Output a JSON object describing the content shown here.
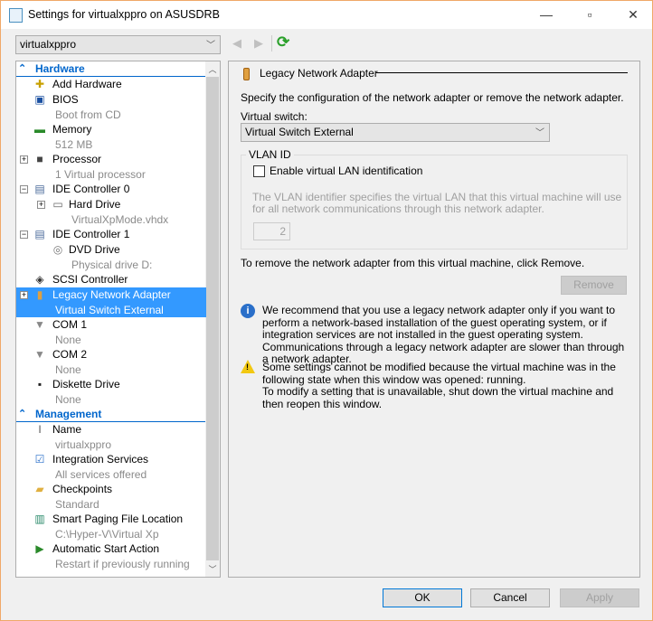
{
  "window": {
    "title": "Settings for virtualxppro on ASUSDRB",
    "minimize": "—",
    "maximize": "▫",
    "close": "✕"
  },
  "vm_selector": {
    "value": "virtualxppro"
  },
  "toolbar": {
    "back": "◀",
    "forward": "▶",
    "refresh": "⟳"
  },
  "tree": {
    "hardware_header": "Hardware",
    "management_header": "Management",
    "hardware": [
      {
        "label": "Add Hardware",
        "sub": null,
        "icon": "add-hardware-icon"
      },
      {
        "label": "BIOS",
        "sub": "Boot from CD",
        "icon": "bios-icon"
      },
      {
        "label": "Memory",
        "sub": "512 MB",
        "icon": "memory-icon"
      },
      {
        "label": "Processor",
        "sub": "1 Virtual processor",
        "icon": "processor-icon",
        "expander": "+"
      },
      {
        "label": "IDE Controller 0",
        "sub": null,
        "icon": "ide-controller-icon",
        "expander": "−"
      },
      {
        "label": "Hard Drive",
        "sub": "VirtualXpMode.vhdx",
        "icon": "hard-drive-icon",
        "expander": "+",
        "level": 2
      },
      {
        "label": "IDE Controller 1",
        "sub": null,
        "icon": "ide-controller-icon",
        "expander": "−"
      },
      {
        "label": "DVD Drive",
        "sub": "Physical drive D:",
        "icon": "dvd-drive-icon",
        "level": 2
      },
      {
        "label": "SCSI Controller",
        "sub": null,
        "icon": "scsi-controller-icon"
      },
      {
        "label": "Legacy Network Adapter",
        "sub": "Virtual Switch External",
        "icon": "network-adapter-icon",
        "expander": "+",
        "selected": true
      },
      {
        "label": "COM 1",
        "sub": "None",
        "icon": "com-port-icon"
      },
      {
        "label": "COM 2",
        "sub": "None",
        "icon": "com-port-icon"
      },
      {
        "label": "Diskette Drive",
        "sub": "None",
        "icon": "diskette-icon"
      }
    ],
    "management": [
      {
        "label": "Name",
        "sub": "virtualxppro",
        "icon": "name-icon"
      },
      {
        "label": "Integration Services",
        "sub": "All services offered",
        "icon": "integration-services-icon"
      },
      {
        "label": "Checkpoints",
        "sub": "Standard",
        "icon": "checkpoints-icon"
      },
      {
        "label": "Smart Paging File Location",
        "sub": "C:\\Hyper-V\\Virtual Xp",
        "icon": "smart-paging-icon"
      },
      {
        "label": "Automatic Start Action",
        "sub": "Restart if previously running",
        "icon": "automatic-start-icon"
      }
    ]
  },
  "panel": {
    "title": "Legacy Network Adapter",
    "description": "Specify the configuration of the network adapter or remove the network adapter.",
    "virtual_switch_label": "Virtual switch:",
    "virtual_switch_value": "Virtual Switch External",
    "vlan_group": "VLAN ID",
    "vlan_checkbox": "Enable virtual LAN identification",
    "vlan_checked": false,
    "vlan_help": "The VLAN identifier specifies the virtual LAN that this virtual machine will use for all network communications through this network adapter.",
    "vlan_value": "2",
    "remove_text": "To remove the network adapter from this virtual machine, click Remove.",
    "remove_button": "Remove",
    "info_text": "We recommend that you use a legacy network adapter only if you want to perform a network-based installation of the guest operating system, or if integration services are not installed in the guest operating system. Communications through a legacy network adapter are slower than through a network adapter.",
    "warning_text_1": "Some settings cannot be modified because the virtual machine was in the following state when this window was opened: running.",
    "warning_text_2": "To modify a setting that is unavailable, shut down the virtual machine and then reopen this window."
  },
  "footer": {
    "ok": "OK",
    "cancel": "Cancel",
    "apply": "Apply"
  }
}
